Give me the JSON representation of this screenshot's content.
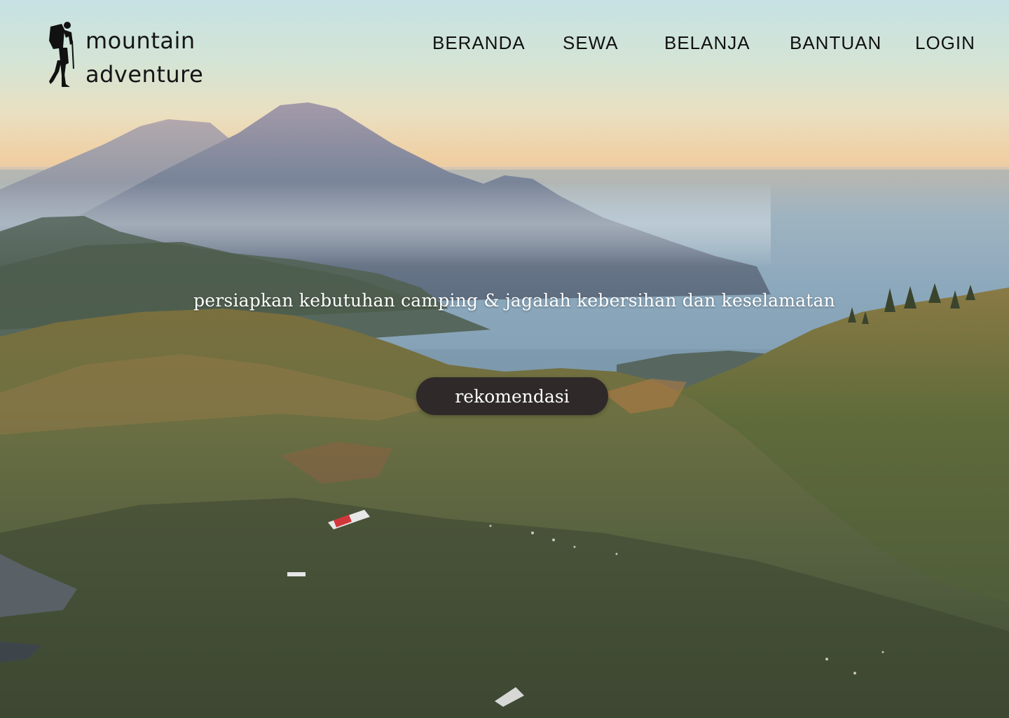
{
  "brand": {
    "line1": "mountain",
    "line2": "adventure",
    "logo_icon": "hiker-icon"
  },
  "nav": {
    "items": [
      {
        "label": "BERANDA"
      },
      {
        "label": "SEWA"
      },
      {
        "label": "BELANJA"
      },
      {
        "label": "BANTUAN"
      },
      {
        "label": "LOGIN"
      }
    ]
  },
  "hero": {
    "tagline": "persiapkan kebutuhan camping & jagalah kebersihan dan keselamatan",
    "cta_label": "rekomendasi"
  },
  "colors": {
    "text_dark": "#111111",
    "button_bg": "#2f2a29",
    "button_text": "#ffffff"
  }
}
